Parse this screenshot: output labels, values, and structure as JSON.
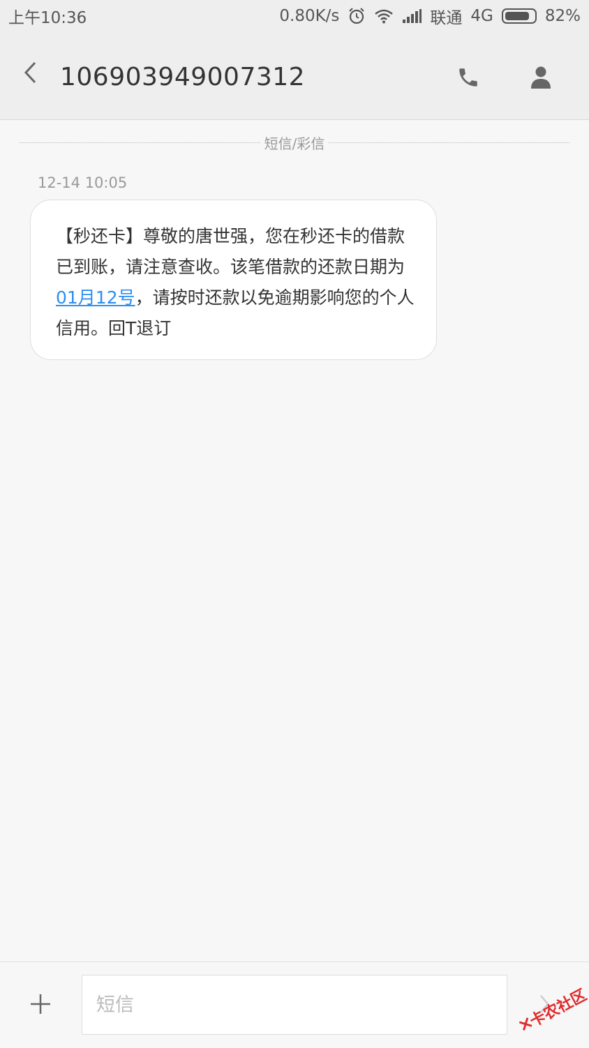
{
  "status_bar": {
    "time": "上午10:36",
    "net_speed": "0.80K/s",
    "carrier": "联通",
    "network": "4G",
    "battery": "82%",
    "battery_level": 0.82,
    "icons": [
      "alarm-icon",
      "wifi-icon",
      "signal-icon",
      "battery-icon"
    ]
  },
  "header": {
    "title": "106903949007312",
    "icons": [
      "back-arrow-icon",
      "phone-icon",
      "contact-icon"
    ]
  },
  "thread": {
    "type_label": "短信/彩信",
    "messages": [
      {
        "time": "12-14 10:05",
        "text_before": "【秒还卡】尊敬的唐世强，您在秒还卡的借款已到账，请注意查收。该笔借款的还款日期为",
        "link": "01月12号",
        "text_after": "，请按时还款以免逾期影响您的个人信用。回T退订"
      }
    ]
  },
  "composer": {
    "placeholder": "短信",
    "value": "",
    "icons": [
      "plus-icon",
      "send-arrow-icon"
    ]
  },
  "watermark": {
    "text": "卡农社区"
  },
  "colors": {
    "link": "#2b8ef0",
    "background": "#f7f7f7",
    "appbar": "#eeeeee",
    "watermark": "#e02a2a"
  }
}
